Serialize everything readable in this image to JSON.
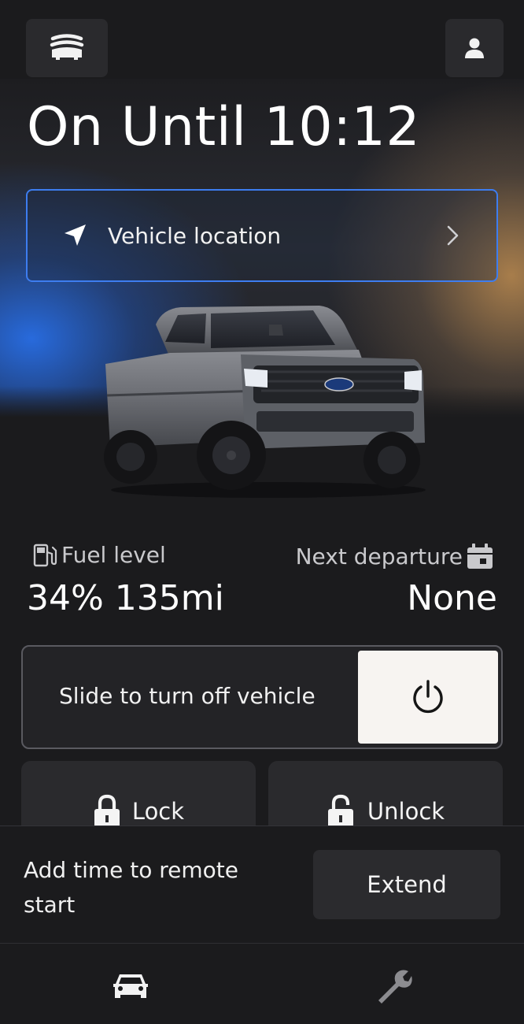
{
  "header": {
    "status_title": "On Until 10:12",
    "menu_icon": "stacked-lines-car-icon",
    "profile_icon": "person-icon"
  },
  "location": {
    "label": "Vehicle location",
    "icon": "navigation-arrow-icon",
    "chevron": "chevron-right-icon"
  },
  "vehicle": {
    "image": "gray pickup truck",
    "badge_text": "Ford"
  },
  "stats": {
    "fuel_label": "Fuel level",
    "fuel_value": "34% 135mi",
    "fuel_icon": "fuel-pump-icon",
    "departure_label": "Next departure",
    "departure_value": "None",
    "departure_icon": "calendar-icon"
  },
  "slider": {
    "label": "Slide to turn off vehicle",
    "icon": "power-icon"
  },
  "actions": {
    "lock_label": "Lock",
    "unlock_label": "Unlock"
  },
  "remote_start": {
    "text": "Add time to remote start",
    "extend_label": "Extend"
  },
  "tabs": [
    {
      "icon": "car-icon",
      "active": true
    },
    {
      "icon": "wrench-icon",
      "active": false
    }
  ],
  "colors": {
    "background": "#1b1b1d",
    "accent_blue": "#3d7df0",
    "card": "#2a2a2d",
    "knob": "#f7f4f1"
  }
}
